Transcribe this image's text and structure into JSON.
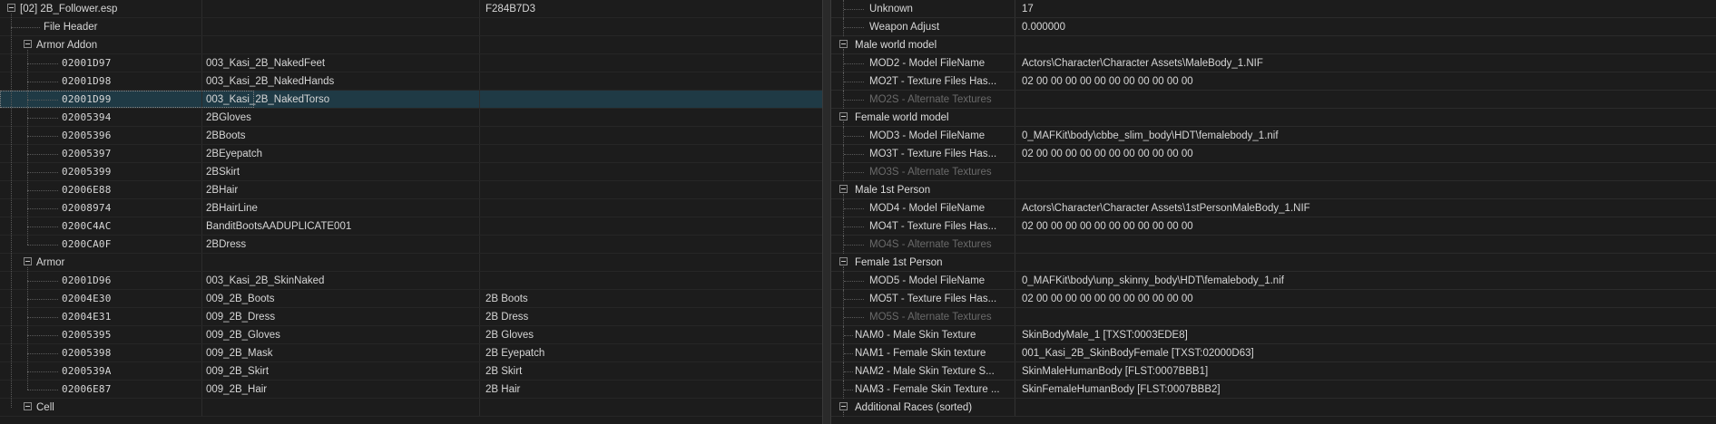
{
  "tree": {
    "root": {
      "label": "[02] 2B_Follower.esp",
      "value": "F284B7D3"
    },
    "file_header": "File Header",
    "armor_addon": {
      "label": "Armor Addon",
      "rows": [
        {
          "id": "02001D97",
          "edid": "003_Kasi_2B_NakedFeet",
          "name": ""
        },
        {
          "id": "02001D98",
          "edid": "003_Kasi_2B_NakedHands",
          "name": ""
        },
        {
          "id": "02001D99",
          "edid": "003_Kasi_2B_NakedTorso",
          "name": ""
        },
        {
          "id": "02005394",
          "edid": "2BGloves",
          "name": ""
        },
        {
          "id": "02005396",
          "edid": "2BBoots",
          "name": ""
        },
        {
          "id": "02005397",
          "edid": "2BEyepatch",
          "name": ""
        },
        {
          "id": "02005399",
          "edid": "2BSkirt",
          "name": ""
        },
        {
          "id": "02006E88",
          "edid": "2BHair",
          "name": ""
        },
        {
          "id": "02008974",
          "edid": "2BHairLine",
          "name": ""
        },
        {
          "id": "0200C4AC",
          "edid": "BanditBootsAADUPLICATE001",
          "name": ""
        },
        {
          "id": "0200CA0F",
          "edid": "2BDress",
          "name": ""
        }
      ]
    },
    "armor": {
      "label": "Armor",
      "rows": [
        {
          "id": "02001D96",
          "edid": "003_Kasi_2B_SkinNaked",
          "name": ""
        },
        {
          "id": "02004E30",
          "edid": "009_2B_Boots",
          "name": "2B Boots"
        },
        {
          "id": "02004E31",
          "edid": "009_2B_Dress",
          "name": "2B Dress"
        },
        {
          "id": "02005395",
          "edid": "009_2B_Gloves",
          "name": "2B Gloves"
        },
        {
          "id": "02005398",
          "edid": "009_2B_Mask",
          "name": "2B Eyepatch"
        },
        {
          "id": "0200539A",
          "edid": "009_2B_Skirt",
          "name": "2B Skirt"
        },
        {
          "id": "02006E87",
          "edid": "009_2B_Hair",
          "name": "2B Hair"
        }
      ]
    },
    "cell": "Cell"
  },
  "details": {
    "rows": [
      {
        "kind": "child",
        "name": "Unknown",
        "value": "17"
      },
      {
        "kind": "child",
        "name": "Weapon Adjust",
        "value": "0.000000"
      },
      {
        "kind": "group",
        "name": "Male world model",
        "value": ""
      },
      {
        "kind": "child",
        "name": "MOD2 - Model FileName",
        "value": "Actors\\Character\\Character Assets\\MaleBody_1.NIF"
      },
      {
        "kind": "child",
        "name": "MO2T - Texture Files Has...",
        "value": "02 00 00 00 00 00 00 00 00 00 00 00"
      },
      {
        "kind": "child-grey",
        "name": "MO2S - Alternate Textures",
        "value": ""
      },
      {
        "kind": "group",
        "name": "Female world model",
        "value": ""
      },
      {
        "kind": "child",
        "name": "MOD3 - Model FileName",
        "value": "0_MAFKit\\body\\cbbe_slim_body\\HDT\\femalebody_1.nif"
      },
      {
        "kind": "child",
        "name": "MO3T - Texture Files Has...",
        "value": "02 00 00 00 00 00 00 00 00 00 00 00"
      },
      {
        "kind": "child-grey",
        "name": "MO3S - Alternate Textures",
        "value": ""
      },
      {
        "kind": "group",
        "name": "Male 1st Person",
        "value": ""
      },
      {
        "kind": "child",
        "name": "MOD4 - Model FileName",
        "value": "Actors\\Character\\Character Assets\\1stPersonMaleBody_1.NIF"
      },
      {
        "kind": "child",
        "name": "MO4T - Texture Files Has...",
        "value": "02 00 00 00 00 00 00 00 00 00 00 00"
      },
      {
        "kind": "child-grey",
        "name": "MO4S - Alternate Textures",
        "value": ""
      },
      {
        "kind": "group",
        "name": "Female 1st Person",
        "value": ""
      },
      {
        "kind": "child",
        "name": "MOD5 - Model FileName",
        "value": "0_MAFKit\\body\\unp_skinny_body\\HDT\\femalebody_1.nif"
      },
      {
        "kind": "child",
        "name": "MO5T - Texture Files Has...",
        "value": "02 00 00 00 00 00 00 00 00 00 00 00"
      },
      {
        "kind": "child-grey",
        "name": "MO5S - Alternate Textures",
        "value": ""
      },
      {
        "kind": "top",
        "name": "NAM0 - Male Skin Texture",
        "value": "SkinBodyMale_1 [TXST:0003EDE8]"
      },
      {
        "kind": "top",
        "name": "NAM1 - Female Skin texture",
        "value": "001_Kasi_2B_SkinBodyFemale [TXST:02000D63]"
      },
      {
        "kind": "top",
        "name": "NAM2 - Male Skin Texture S...",
        "value": "SkinMaleHumanBody [FLST:0007BBB1]"
      },
      {
        "kind": "top",
        "name": "NAM3 - Female Skin Texture ...",
        "value": "SkinFemaleHumanBody [FLST:0007BBB2]"
      },
      {
        "kind": "group",
        "name": "Additional Races (sorted)",
        "value": ""
      }
    ]
  },
  "icons": {
    "expand": "minus-box-icon"
  },
  "colors": {
    "selected_row": "#1f3a45",
    "background": "#1c1c1c",
    "text": "#d6d6d6",
    "disabled_text": "#6a6a6a"
  }
}
